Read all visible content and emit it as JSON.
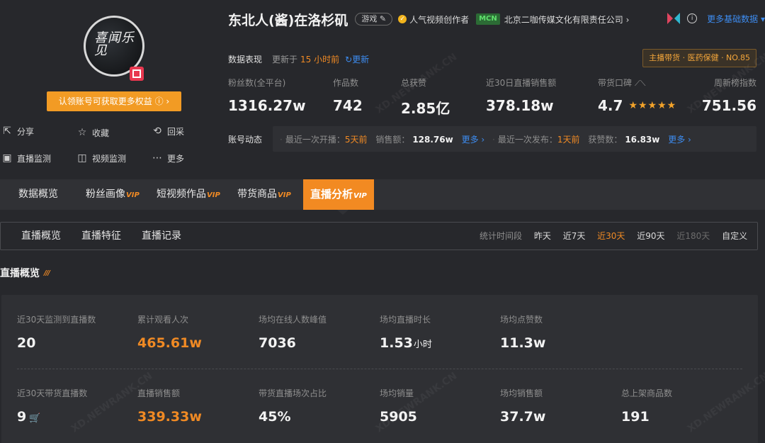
{
  "profile": {
    "avatar_text": "喜闻乐见",
    "claim_button": "认领账号可获取更多权益 ⓘ ›",
    "actions": [
      {
        "label": "分享",
        "icon": "share-icon"
      },
      {
        "label": "收藏",
        "icon": "star-icon"
      },
      {
        "label": "回采",
        "icon": "recollect-icon"
      },
      {
        "label": "直播监测",
        "icon": "live-monitor-icon"
      },
      {
        "label": "视频监测",
        "icon": "video-monitor-icon"
      },
      {
        "label": "更多",
        "icon": "more-icon"
      }
    ]
  },
  "header": {
    "nickname": "东北人(酱)在洛杉矶",
    "category_tag": "游戏",
    "verification": "人气视频创作者",
    "mcn_badge": "MCN",
    "mcn_company": "北京二咖传媒文化有限责任公司 ›",
    "more_basic_data": "更多基础数据 ▾"
  },
  "performance": {
    "label": "数据表现",
    "updated_prefix": "更新于",
    "updated_hours": "15 小时前",
    "refresh": "↻更新",
    "rank_badge": "主播带货 · 医药保健 · NO.85"
  },
  "stats": [
    {
      "label": "粉丝数(全平台)",
      "value": "1316.27w"
    },
    {
      "label": "作品数",
      "value": "742"
    },
    {
      "label": "总获赞",
      "value": "2.85亿"
    },
    {
      "label": "近30日直播销售额",
      "value": "378.18w"
    },
    {
      "label": "带货口碑",
      "value": "4.7",
      "stars": "★★★★★",
      "trend_icon": "trend-chart-icon"
    },
    {
      "label": "周新榜指数",
      "value": "751.56"
    }
  ],
  "dynamics": {
    "label": "账号动态",
    "live": {
      "prefix": "最近一次开播：",
      "when": "5天前",
      "sales_label": "销售额：",
      "sales": "128.76w",
      "more": "更多 ›"
    },
    "post": {
      "prefix": "最近一次发布：",
      "when": "1天前",
      "likes_label": "获赞数：",
      "likes": "16.83w",
      "more": "更多 ›"
    }
  },
  "main_tabs": [
    {
      "label": "数据概览",
      "vip": ""
    },
    {
      "label": "粉丝画像",
      "vip": "VIP"
    },
    {
      "label": "短视频作品",
      "vip": "VIP"
    },
    {
      "label": "带货商品",
      "vip": "VIP"
    },
    {
      "label": "直播分析",
      "vip": "VIP",
      "active": true
    }
  ],
  "sub_tabs": [
    "直播概览",
    "直播特征",
    "直播记录"
  ],
  "period": {
    "label": "统计时间段",
    "options": [
      {
        "label": "昨天",
        "state": "normal"
      },
      {
        "label": "近7天",
        "state": "normal"
      },
      {
        "label": "近30天",
        "state": "active"
      },
      {
        "label": "近90天",
        "state": "normal"
      },
      {
        "label": "近180天",
        "state": "disabled"
      },
      {
        "label": "自定义",
        "state": "normal"
      }
    ]
  },
  "overview": {
    "title": "直播概览",
    "row1": [
      {
        "label": "近30天监测到直播数",
        "value": "20",
        "unit": "",
        "highlight": false
      },
      {
        "label": "累计观看人次",
        "value": "465.61w",
        "unit": "",
        "highlight": true
      },
      {
        "label": "场均在线人数峰值",
        "value": "7036",
        "unit": "",
        "highlight": false
      },
      {
        "label": "场均直播时长",
        "value": "1.53",
        "unit": "小时",
        "highlight": false
      },
      {
        "label": "场均点赞数",
        "value": "11.3w",
        "unit": "",
        "highlight": false
      }
    ],
    "row2": [
      {
        "label": "近30天带货直播数",
        "value": "9",
        "unit": "",
        "highlight": false,
        "cart_icon": true
      },
      {
        "label": "直播销售额",
        "value": "339.33w",
        "unit": "",
        "highlight": true
      },
      {
        "label": "带货直播场次占比",
        "value": "45%",
        "unit": "",
        "highlight": false
      },
      {
        "label": "场均销量",
        "value": "5905",
        "unit": "",
        "highlight": false
      },
      {
        "label": "场均销售额",
        "value": "37.7w",
        "unit": "",
        "highlight": false
      },
      {
        "label": "总上架商品数",
        "value": "191",
        "unit": "",
        "highlight": false
      }
    ]
  },
  "watermark": "XD.NEWRANK.CN",
  "colors": {
    "background": "#27282c",
    "panel": "#2f3034",
    "accent_orange": "#f28a22",
    "link_blue": "#3d8cf0",
    "star_gold": "#f3a32a"
  }
}
